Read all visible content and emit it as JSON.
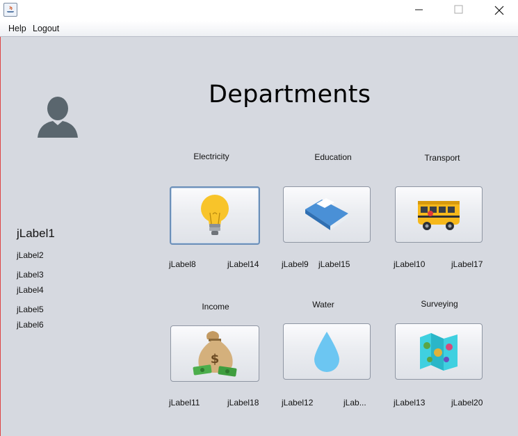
{
  "window": {
    "minimize_glyph": "—",
    "maximize_glyph": "☐",
    "close_glyph": "✕"
  },
  "menu": [
    "Help",
    "Logout"
  ],
  "heading": "Departments",
  "sidebar": {
    "name": "jLabel1",
    "labels": [
      "jLabel2",
      "jLabel3",
      "jLabel4",
      "jLabel5",
      "jLabel6"
    ]
  },
  "departments": [
    {
      "title": "Electricity",
      "icon": "lightbulb-icon",
      "labels": [
        "jLabel8",
        "jLabel14"
      ]
    },
    {
      "title": "Education",
      "icon": "book-icon",
      "labels": [
        "jLabel9",
        "jLabel15"
      ]
    },
    {
      "title": "Transport",
      "icon": "bus-icon",
      "labels": [
        "jLabel10",
        "jLabel17"
      ]
    },
    {
      "title": "Income",
      "icon": "money-bag-icon",
      "labels": [
        "jLabel11",
        "jLabel18"
      ]
    },
    {
      "title": "Water",
      "icon": "water-drop-icon",
      "labels": [
        "jLabel12",
        "jLab..."
      ]
    },
    {
      "title": "Surveying",
      "icon": "map-icon",
      "labels": [
        "jLabel13",
        "jLabel20"
      ]
    }
  ]
}
